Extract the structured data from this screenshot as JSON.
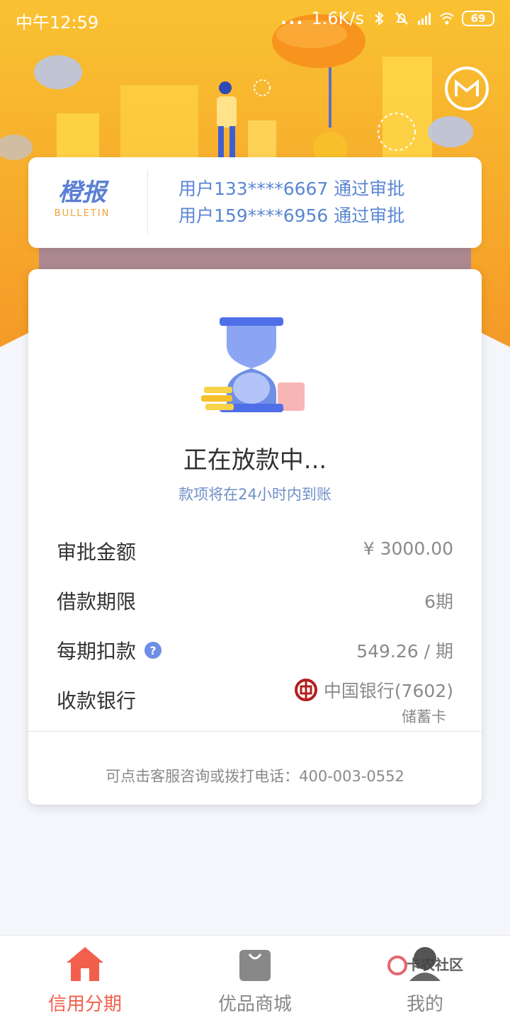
{
  "status_bar": {
    "time": "中午12:59",
    "network_speed": "1.6K/s",
    "battery": "69",
    "dots": "..."
  },
  "colors": {
    "banner_orange": "#f7a62b",
    "accent_blue": "#5a86d2",
    "nav_active": "#f2604d"
  },
  "bulletin": {
    "brand_cn": "橙报",
    "brand_en": "BULLETIN",
    "notices": [
      "用户133****6667 通过审批",
      "用户159****6956 通过审批"
    ]
  },
  "loan_status": {
    "title": "正在放款中...",
    "subtitle": "款项将在24小时内到账"
  },
  "details": {
    "approval_amount_label": "审批金额",
    "approval_amount_value": "¥ 3000.00",
    "term_label": "借款期限",
    "term_value": "6期",
    "installment_label": "每期扣款",
    "installment_value": "549.26 / 期",
    "help_icon": "question-icon",
    "bank_label": "收款银行",
    "bank_name": "中国银行(7602)",
    "bank_card_type": "储蓄卡"
  },
  "contact": "可点击客服咨询或拨打电话：400-003-0552",
  "bottom_nav": [
    {
      "label": "信用分期",
      "icon": "home-icon",
      "active": true
    },
    {
      "label": "优品商城",
      "icon": "shopping-bag-icon",
      "active": false
    },
    {
      "label": "我的",
      "icon": "profile-icon",
      "active": false
    }
  ],
  "watermark": "卡农社区"
}
